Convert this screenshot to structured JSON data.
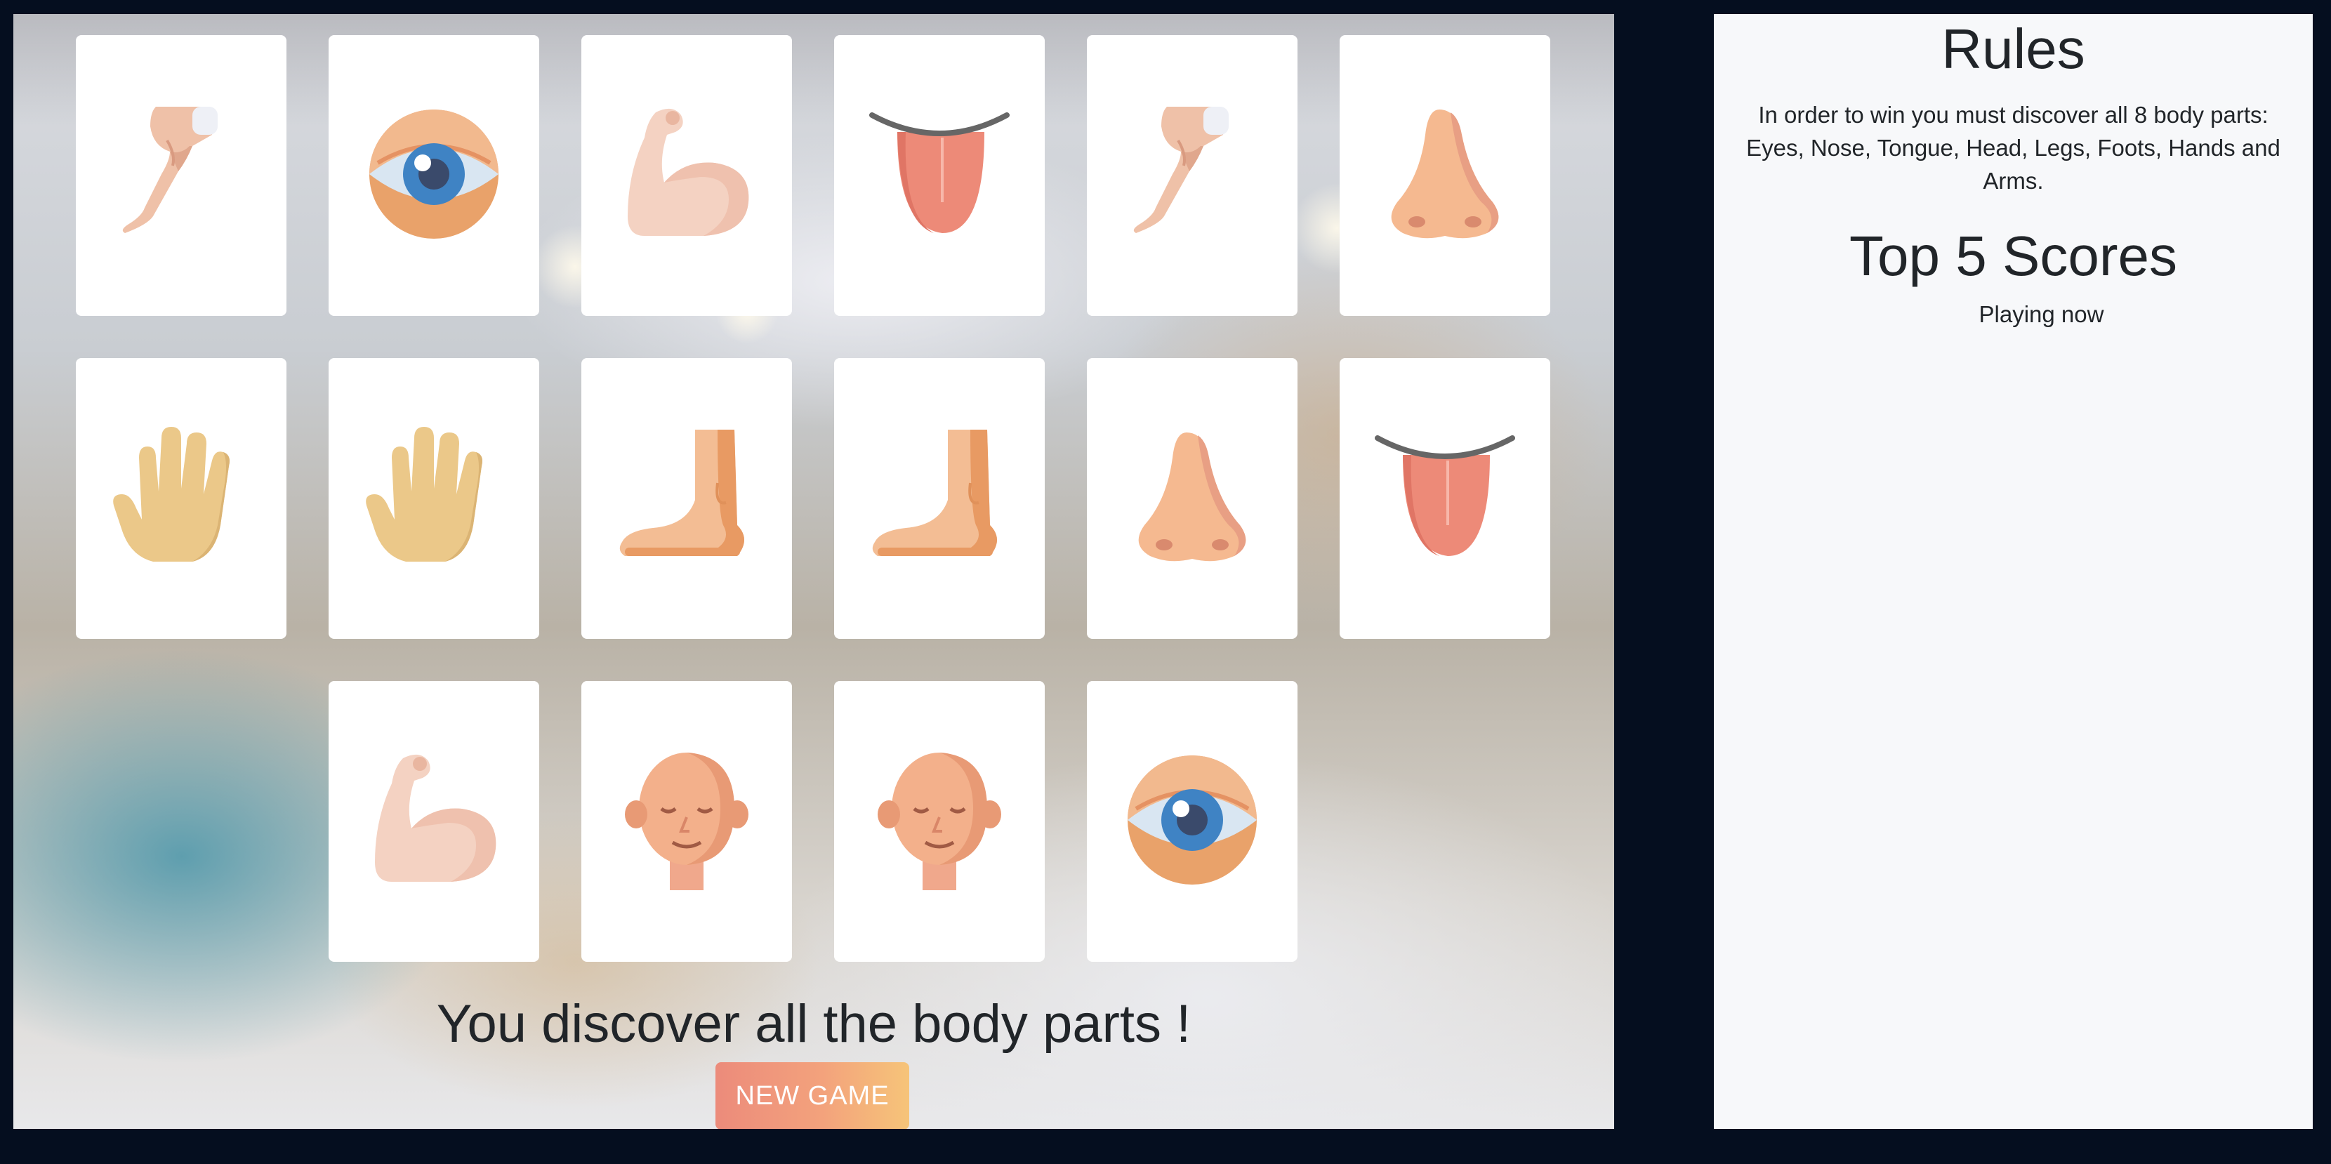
{
  "game": {
    "cards": [
      {
        "part": "leg",
        "icon": "leg-icon"
      },
      {
        "part": "eye",
        "icon": "eye-icon"
      },
      {
        "part": "arm",
        "icon": "arm-icon"
      },
      {
        "part": "tongue",
        "icon": "tongue-icon"
      },
      {
        "part": "leg",
        "icon": "leg-icon"
      },
      {
        "part": "nose",
        "icon": "nose-icon"
      },
      {
        "part": "hand",
        "icon": "hand-icon"
      },
      {
        "part": "hand",
        "icon": "hand-icon"
      },
      {
        "part": "foot",
        "icon": "foot-icon"
      },
      {
        "part": "foot",
        "icon": "foot-icon"
      },
      {
        "part": "nose",
        "icon": "nose-icon"
      },
      {
        "part": "tongue",
        "icon": "tongue-icon"
      },
      {
        "part": "arm",
        "icon": "arm-icon"
      },
      {
        "part": "head",
        "icon": "head-icon"
      },
      {
        "part": "head",
        "icon": "head-icon"
      },
      {
        "part": "eye",
        "icon": "eye-icon"
      }
    ],
    "win_message": "You discover all the body parts !",
    "new_game_label": "NEW GAME"
  },
  "panel": {
    "rules_title": "Rules",
    "rules_text": "In order to win you must discover all 8 body parts: Eyes, Nose, Tongue, Head, Legs, Foots, Hands and Arms.",
    "scores_title": "Top 5 Scores",
    "playing_now": "Playing now"
  },
  "colors": {
    "page_background": "#050e1f",
    "panel_background": "#f7f8fa",
    "button_gradient_start": "#ec8b7b",
    "button_gradient_end": "#f6c479",
    "text": "#212529"
  }
}
